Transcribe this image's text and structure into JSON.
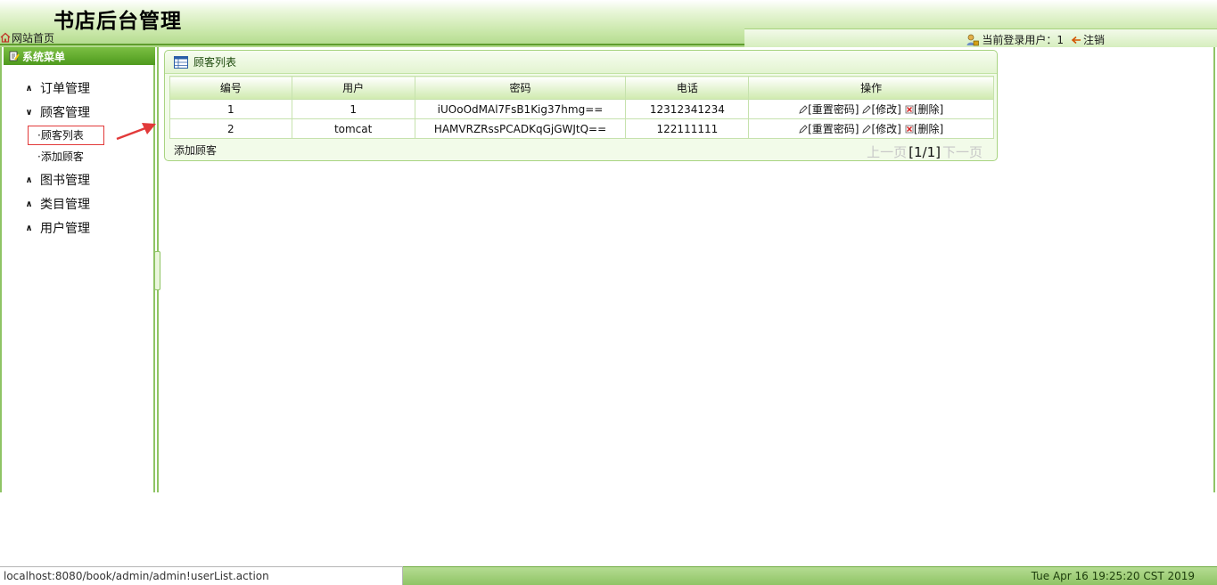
{
  "header": {
    "site_title": "书店后台管理",
    "home_link": "网站首页",
    "current_user_label": "当前登录用户：",
    "current_user": "1",
    "logout": "注销"
  },
  "sidebar": {
    "title": "系统菜单",
    "items": [
      {
        "label": "订单管理",
        "expanded": false
      },
      {
        "label": "顾客管理",
        "expanded": true,
        "children": [
          "·顾客列表",
          "·添加顾客"
        ]
      },
      {
        "label": "图书管理",
        "expanded": false
      },
      {
        "label": "类目管理",
        "expanded": false
      },
      {
        "label": "用户管理",
        "expanded": false
      }
    ]
  },
  "panel": {
    "title": "顾客列表",
    "columns": [
      "编号",
      "用户",
      "密码",
      "电话",
      "操作"
    ],
    "rows": [
      {
        "id": "1",
        "user": "1",
        "password": "iUOoOdMAl7FsB1Kig37hmg==",
        "phone": "12312341234"
      },
      {
        "id": "2",
        "user": "tomcat",
        "password": "HAMVRZRssPCADKqGjGWJtQ==",
        "phone": "122111111"
      }
    ],
    "actions": {
      "reset": "[重置密码]",
      "edit": "[修改]",
      "delete": "[删除]"
    },
    "add_link": "添加顾客",
    "pager": {
      "prev": "上一页",
      "current": "[1/1]",
      "next": "下一页"
    }
  },
  "status_url": "localhost:8080/book/admin/admin!userList.action",
  "clock": "Tue Apr 16 19:25:20 CST 2019",
  "colors": {
    "accent": "#4e9a1d",
    "border": "#8fc465",
    "highlight": "#e23a3a"
  }
}
